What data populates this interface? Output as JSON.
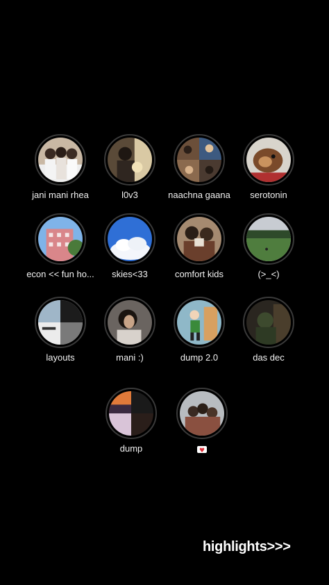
{
  "highlights": [
    {
      "label": "jani mani rhea",
      "icon": "photo-friends-group"
    },
    {
      "label": "l0v3",
      "icon": "photo-couple"
    },
    {
      "label": "naachna gaana",
      "icon": "photo-collage"
    },
    {
      "label": "serotonin",
      "icon": "photo-dog"
    },
    {
      "label": "econ << fun ho...",
      "icon": "photo-pink-building"
    },
    {
      "label": "skies<33",
      "icon": "photo-sky-clouds"
    },
    {
      "label": "comfort kids",
      "icon": "photo-friends"
    },
    {
      "label": "(>_<)",
      "icon": "photo-field"
    },
    {
      "label": "layouts",
      "icon": "photo-layout-collage"
    },
    {
      "label": "mani :)",
      "icon": "photo-portrait"
    },
    {
      "label": "dump 2.0",
      "icon": "photo-illustration"
    },
    {
      "label": "das dec",
      "icon": "photo-night-street"
    },
    {
      "label": "dump",
      "icon": "photo-sunset-collage"
    },
    {
      "label": "",
      "icon": "heart-letter-emoji"
    }
  ],
  "footer": {
    "text": "highlights>>>"
  }
}
